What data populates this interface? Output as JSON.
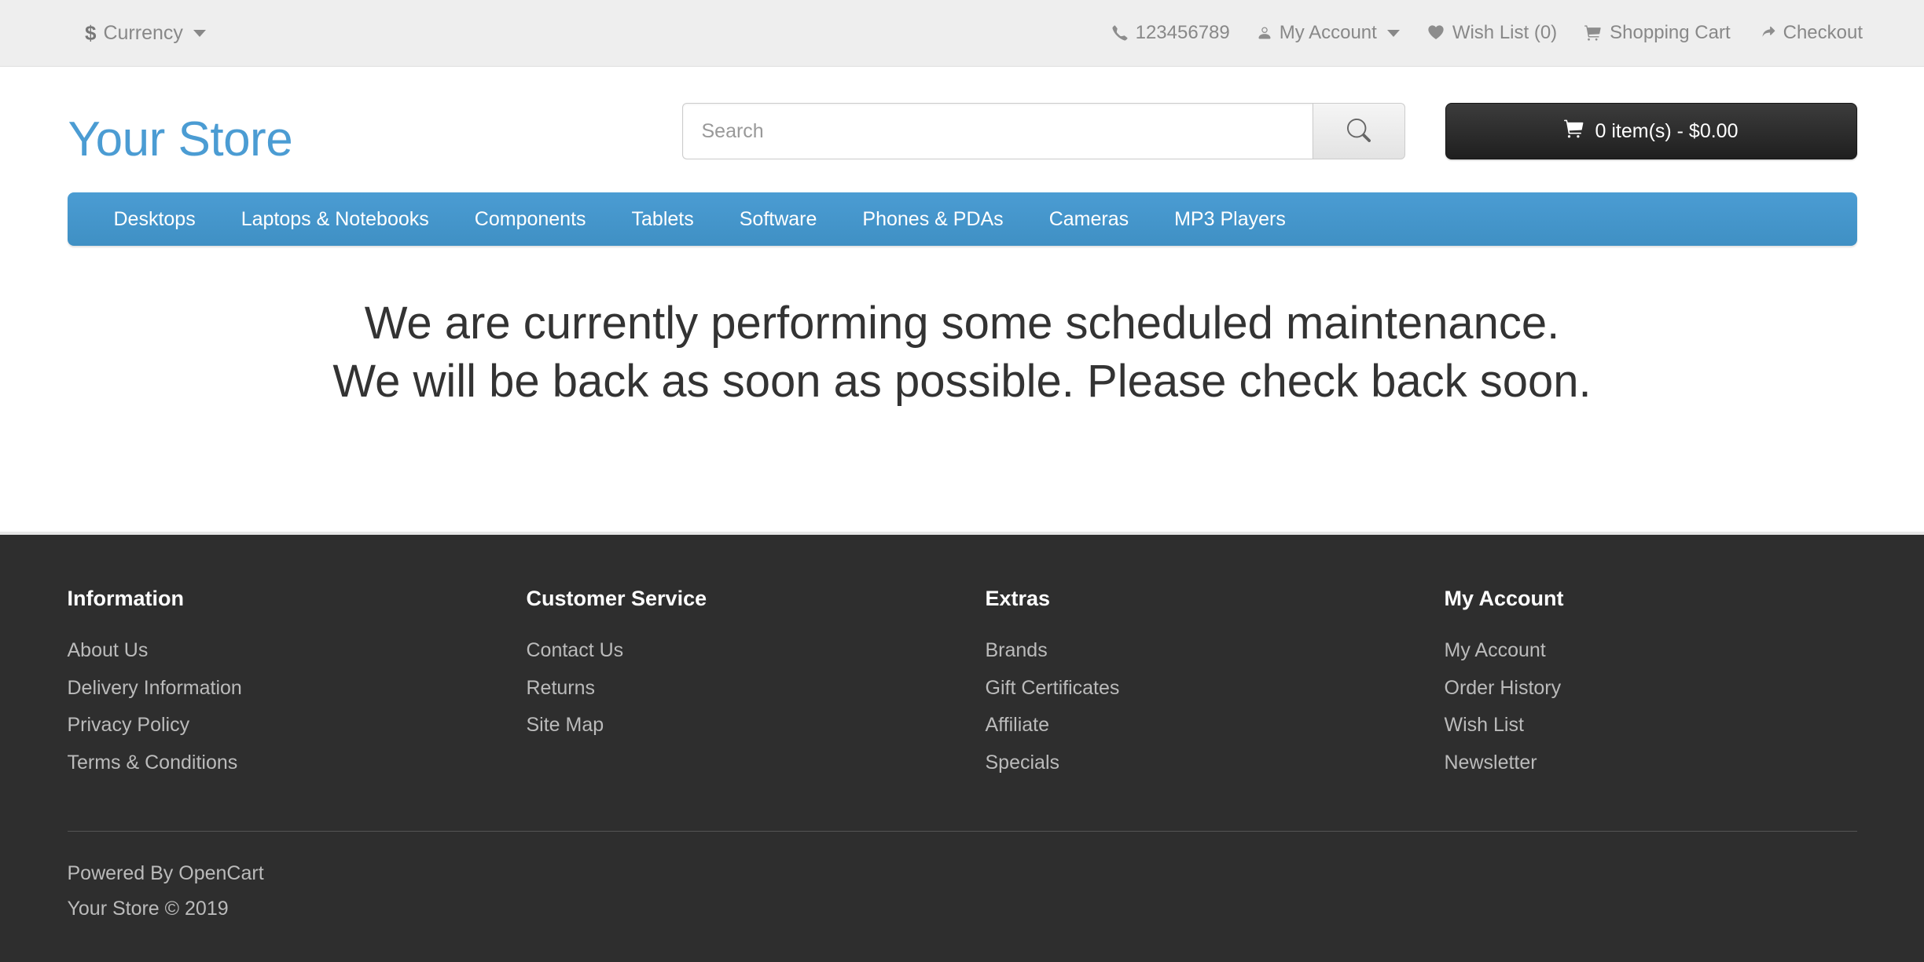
{
  "topbar": {
    "currency": {
      "symbol": "$",
      "label": "Currency"
    },
    "phone": "123456789",
    "my_account": "My Account",
    "wish_list": "Wish List (0)",
    "shopping_cart": "Shopping Cart",
    "checkout": "Checkout"
  },
  "header": {
    "logo": "Your Store",
    "search_placeholder": "Search",
    "search_value": "",
    "cart_label": "0 item(s) - $0.00"
  },
  "nav": {
    "items": [
      {
        "label": "Desktops"
      },
      {
        "label": "Laptops & Notebooks"
      },
      {
        "label": "Components"
      },
      {
        "label": "Tablets"
      },
      {
        "label": "Software"
      },
      {
        "label": "Phones & PDAs"
      },
      {
        "label": "Cameras"
      },
      {
        "label": "MP3 Players"
      }
    ]
  },
  "main": {
    "maintenance_line1": "We are currently performing some scheduled maintenance.",
    "maintenance_line2": "We will be back as soon as possible. Please check back soon."
  },
  "footer": {
    "columns": [
      {
        "title": "Information",
        "links": [
          {
            "label": "About Us"
          },
          {
            "label": "Delivery Information"
          },
          {
            "label": "Privacy Policy"
          },
          {
            "label": "Terms & Conditions"
          }
        ]
      },
      {
        "title": "Customer Service",
        "links": [
          {
            "label": "Contact Us"
          },
          {
            "label": "Returns"
          },
          {
            "label": "Site Map"
          }
        ]
      },
      {
        "title": "Extras",
        "links": [
          {
            "label": "Brands"
          },
          {
            "label": "Gift Certificates"
          },
          {
            "label": "Affiliate"
          },
          {
            "label": "Specials"
          }
        ]
      },
      {
        "title": "My Account",
        "links": [
          {
            "label": "My Account"
          },
          {
            "label": "Order History"
          },
          {
            "label": "Wish List"
          },
          {
            "label": "Newsletter"
          }
        ]
      }
    ],
    "powered_by_prefix": "Powered By ",
    "powered_by_link": "OpenCart",
    "copyright": "Your Store © 2019"
  },
  "colors": {
    "brand_blue": "#4b9cd3",
    "topbar_bg": "#eeeeee",
    "footer_bg": "#2e2e2e",
    "cart_dark": "#2b2b2b",
    "text_muted": "#888888"
  }
}
